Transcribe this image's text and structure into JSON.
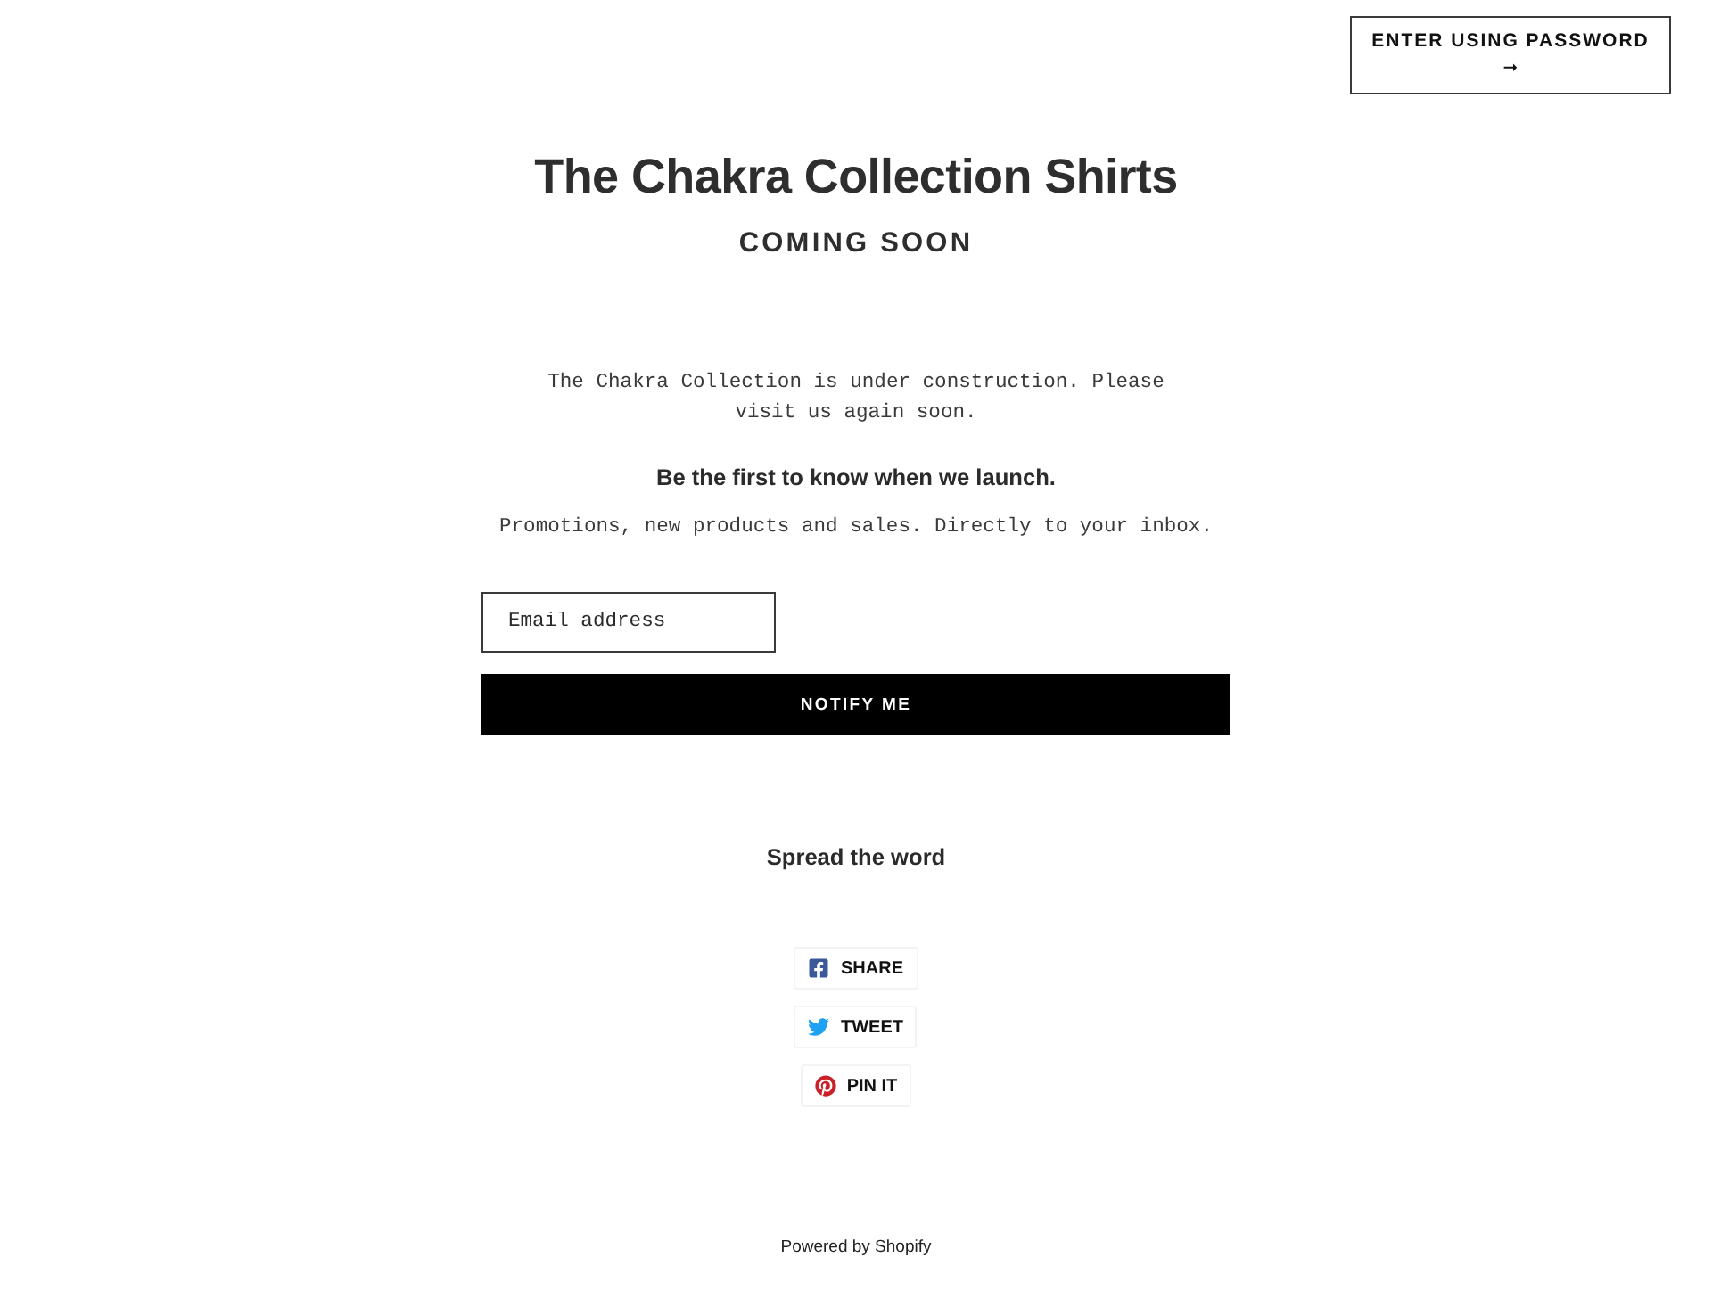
{
  "header": {
    "password_button": {
      "label": "ENTER USING PASSWORD",
      "arrow": "➞"
    }
  },
  "hero": {
    "title": "The Chakra Collection Shirts",
    "subtitle": "COMING SOON"
  },
  "message": "The Chakra Collection is under construction. Please visit us again soon.",
  "signup": {
    "heading": "Be the first to know when we launch.",
    "text": "Promotions, new products and sales. Directly to your inbox.",
    "email_field": {
      "placeholder": "Email address"
    },
    "submit_button": "NOTIFY ME"
  },
  "share": {
    "heading": "Spread the word",
    "buttons": [
      {
        "kind": "facebook",
        "label": "SHARE"
      },
      {
        "kind": "twitter",
        "label": "TWEET"
      },
      {
        "kind": "pinterest",
        "label": "PIN IT"
      }
    ]
  },
  "footer": {
    "powered_by": "Powered by Shopify"
  }
}
